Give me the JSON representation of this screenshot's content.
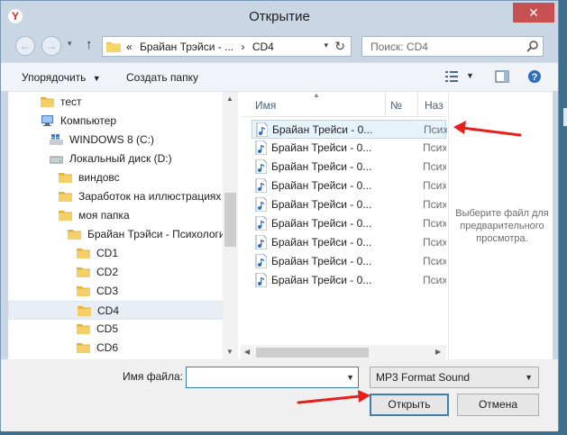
{
  "window": {
    "title": "Открытие",
    "close_glyph": "✕",
    "app_glyph": "Y"
  },
  "nav": {
    "back_glyph": "←",
    "forward_glyph": "→",
    "up_glyph": "↑",
    "breadcrumb_prefix": "«",
    "breadcrumb": [
      "Брайан Трэйси - ...",
      "›",
      "CD4"
    ],
    "refresh_glyph": "↻",
    "search_placeholder": "Поиск: CD4"
  },
  "toolbar": {
    "organize_label": "Упорядочить",
    "new_folder_label": "Создать папку"
  },
  "tree": {
    "items": [
      {
        "label": "тест",
        "icon": "folder-icon"
      },
      {
        "label": "Компьютер",
        "icon": "computer-icon"
      },
      {
        "label": "WINDOWS 8 (C:)",
        "icon": "windows-drive-icon"
      },
      {
        "label": "Локальный диск (D:)",
        "icon": "drive-icon"
      },
      {
        "label": "виндовс",
        "icon": "folder-icon"
      },
      {
        "label": "Заработок на иллюстрациях и",
        "icon": "folder-icon"
      },
      {
        "label": "моя папка",
        "icon": "folder-icon"
      },
      {
        "label": "Брайан Трэйси - Психология",
        "icon": "folder-icon"
      },
      {
        "label": "CD1",
        "icon": "folder-icon"
      },
      {
        "label": "CD2",
        "icon": "folder-icon"
      },
      {
        "label": "CD3",
        "icon": "folder-icon"
      },
      {
        "label": "CD4",
        "icon": "folder-icon"
      },
      {
        "label": "CD5",
        "icon": "folder-icon"
      },
      {
        "label": "CD6",
        "icon": "folder-icon"
      }
    ]
  },
  "files": {
    "columns": [
      "Имя",
      "№",
      "Наз"
    ],
    "rows": [
      {
        "name": "Брайан Трейси - 0...",
        "type": "Психо"
      },
      {
        "name": "Брайан Трейси - 0...",
        "type": "Психо"
      },
      {
        "name": "Брайан Трейси - 0...",
        "type": "Психо"
      },
      {
        "name": "Брайан Трейси - 0...",
        "type": "Психо"
      },
      {
        "name": "Брайан Трейси - 0...",
        "type": "Психо"
      },
      {
        "name": "Брайан Трейси - 0...",
        "type": "Психо"
      },
      {
        "name": "Брайан Трейси - 0...",
        "type": "Психо"
      },
      {
        "name": "Брайан Трейси - 0...",
        "type": "Психо"
      },
      {
        "name": "Брайан Трейси - 0...",
        "type": "Психо"
      }
    ]
  },
  "preview": {
    "text": "Выберите файл для предварительного просмотра."
  },
  "footer": {
    "filename_label": "Имя файла:",
    "filename_value": "",
    "filetype_value": "MP3 Format Sound",
    "open_label": "Открыть",
    "cancel_label": "Отмена"
  },
  "colors": {
    "annotation_arrow": "#e8201c",
    "selection": "#e5f3fb",
    "folder": "#f0c44c"
  }
}
